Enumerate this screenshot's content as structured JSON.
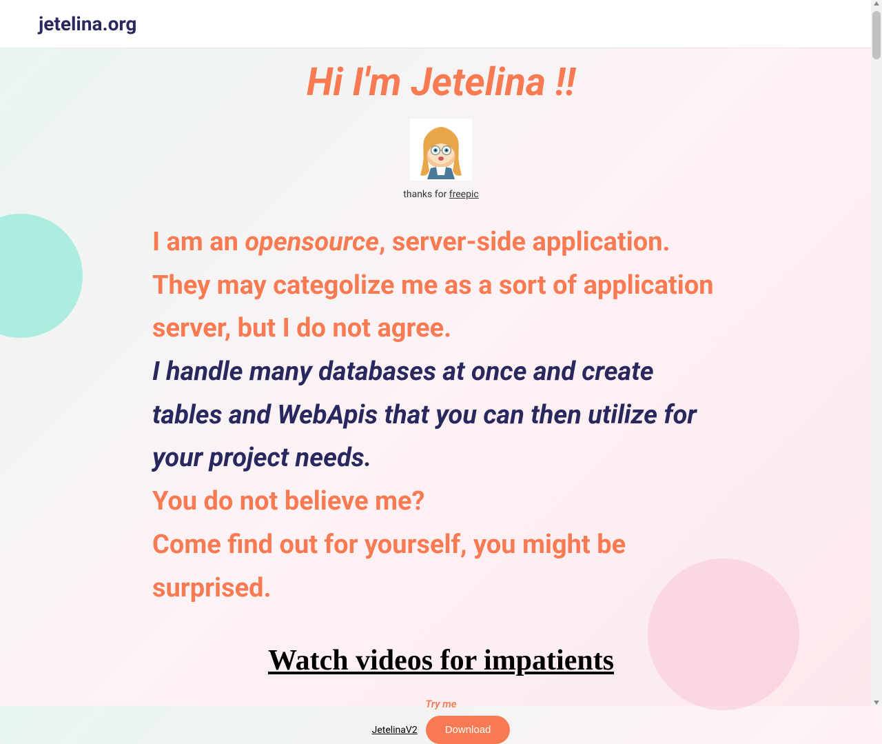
{
  "header": {
    "site_title": "jetelina.org"
  },
  "hero": {
    "title": "Hi I'm Jetelina !!",
    "attribution_prefix": "thanks for ",
    "attribution_link": "freepic"
  },
  "intro": {
    "line1_prefix": "I am an ",
    "line1_opensource": "opensource",
    "line1_suffix": ", server-side application.",
    "line2": "They may categolize me as a sort of application server, but I do not agree.",
    "line3_highlight": "I handle many databases at once and create tables and WebApis that you can then utilize for your project needs.",
    "line4": "You do not believe me?",
    "line5": "Come find out for yourself, you might be surprised."
  },
  "video_section": {
    "heading": "Watch videos for impatients"
  },
  "try_me": {
    "label": "Try me",
    "version_link": "JetelinaV2",
    "download_button": "Download"
  }
}
